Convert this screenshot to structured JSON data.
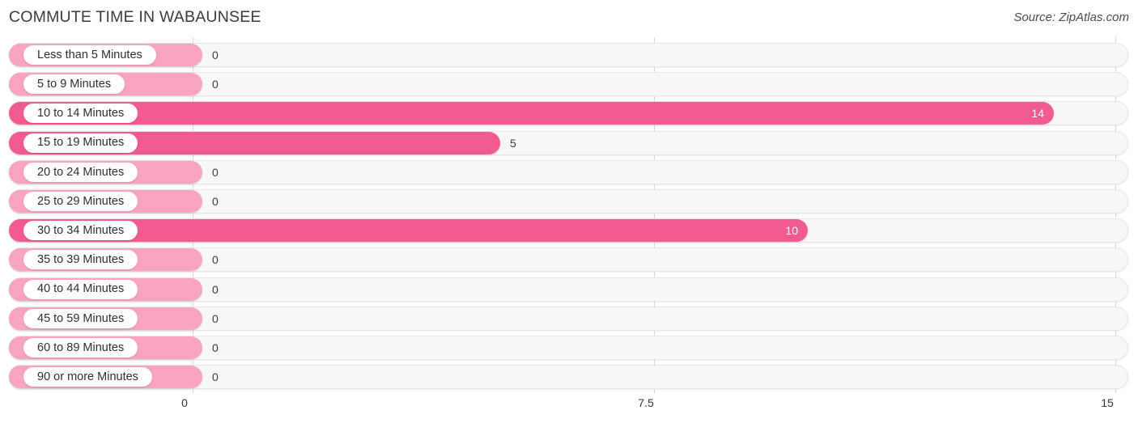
{
  "header": {
    "title": "COMMUTE TIME IN WABAUNSEE",
    "source": "Source: ZipAtlas.com"
  },
  "colors": {
    "bar_strong": "#f25b92",
    "bar_light": "#f7a3c1",
    "track": "#f7f7f7",
    "gridline": "#d8d8d8",
    "title_text": "#3a3a44",
    "value_text": "#3a3a40",
    "value_text_inside": "#ffffff"
  },
  "chart_data": {
    "type": "bar",
    "orientation": "horizontal",
    "title": "COMMUTE TIME IN WABAUNSEE",
    "xlabel": "",
    "ylabel": "",
    "xlim": [
      0,
      15
    ],
    "grid": true,
    "legend": "none",
    "xticks": [
      "0",
      "7.5",
      "15"
    ],
    "xtick_values": [
      0,
      7.5,
      15
    ],
    "categories": [
      "Less than 5 Minutes",
      "5 to 9 Minutes",
      "10 to 14 Minutes",
      "15 to 19 Minutes",
      "20 to 24 Minutes",
      "25 to 29 Minutes",
      "30 to 34 Minutes",
      "35 to 39 Minutes",
      "40 to 44 Minutes",
      "45 to 59 Minutes",
      "60 to 89 Minutes",
      "90 or more Minutes"
    ],
    "values": [
      0,
      0,
      14,
      5,
      0,
      0,
      10,
      0,
      0,
      0,
      0,
      0
    ],
    "value_labels": [
      "0",
      "0",
      "14",
      "5",
      "0",
      "0",
      "10",
      "0",
      "0",
      "0",
      "0",
      "0"
    ]
  },
  "rows": [
    {
      "label": "Less than 5 Minutes",
      "value": 0,
      "value_label": "0"
    },
    {
      "label": "5 to 9 Minutes",
      "value": 0,
      "value_label": "0"
    },
    {
      "label": "10 to 14 Minutes",
      "value": 14,
      "value_label": "14"
    },
    {
      "label": "15 to 19 Minutes",
      "value": 5,
      "value_label": "5"
    },
    {
      "label": "20 to 24 Minutes",
      "value": 0,
      "value_label": "0"
    },
    {
      "label": "25 to 29 Minutes",
      "value": 0,
      "value_label": "0"
    },
    {
      "label": "30 to 34 Minutes",
      "value": 10,
      "value_label": "10"
    },
    {
      "label": "35 to 39 Minutes",
      "value": 0,
      "value_label": "0"
    },
    {
      "label": "40 to 44 Minutes",
      "value": 0,
      "value_label": "0"
    },
    {
      "label": "45 to 59 Minutes",
      "value": 0,
      "value_label": "0"
    },
    {
      "label": "60 to 89 Minutes",
      "value": 0,
      "value_label": "0"
    },
    {
      "label": "90 or more Minutes",
      "value": 0,
      "value_label": "0"
    }
  ],
  "axis": {
    "ticks": [
      {
        "label": "0",
        "value": 0
      },
      {
        "label": "7.5",
        "value": 7.5
      },
      {
        "label": "15",
        "value": 15
      }
    ]
  }
}
